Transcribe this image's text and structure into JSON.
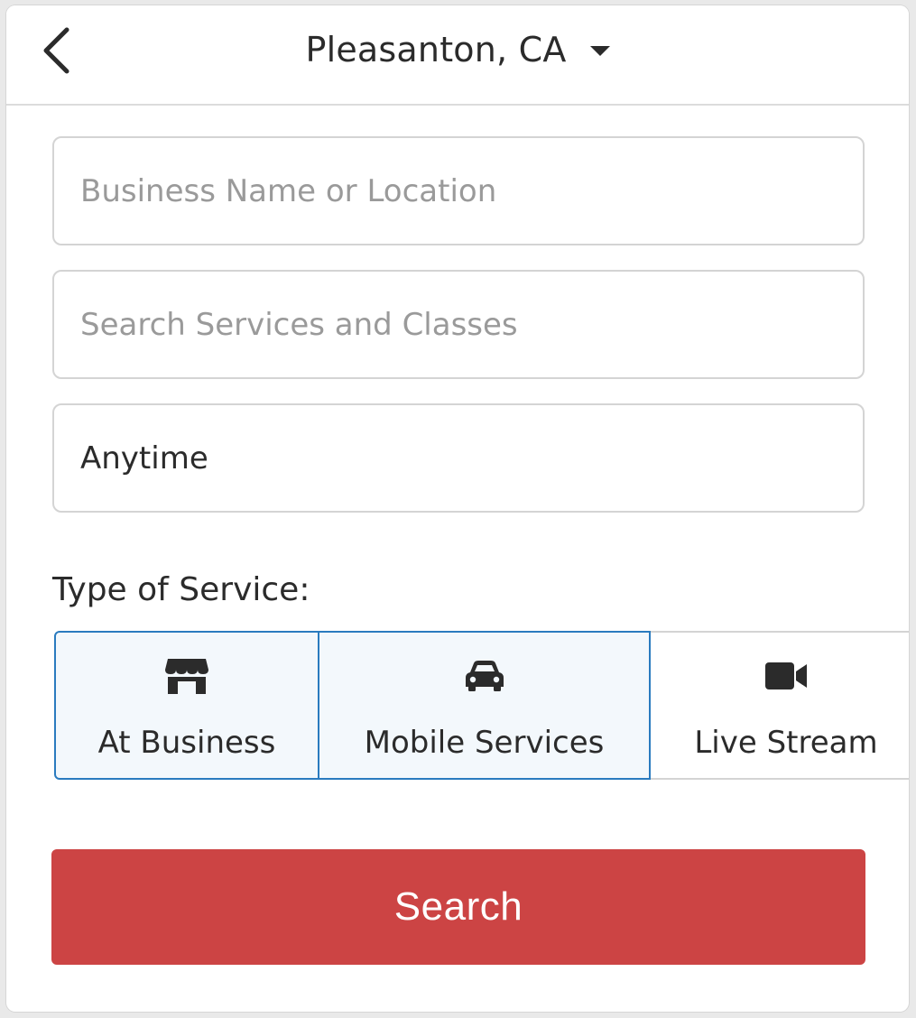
{
  "header": {
    "location": "Pleasanton, CA",
    "back_icon": "chevron-left-icon",
    "dropdown_icon": "caret-down-icon"
  },
  "search": {
    "business_placeholder": "Business Name or Location",
    "services_placeholder": "Search Services and Classes",
    "time_value": "Anytime"
  },
  "service_type": {
    "label": "Type of Service:",
    "options": [
      {
        "label": "At Business",
        "icon": "storefront-icon",
        "selected": true
      },
      {
        "label": "Mobile Services",
        "icon": "car-icon",
        "selected": true
      },
      {
        "label": "Live Stream",
        "icon": "video-camera-icon",
        "selected": false
      }
    ]
  },
  "actions": {
    "search_label": "Search"
  },
  "colors": {
    "accent": "#cc4444",
    "selected_border": "#2a7bbf",
    "selected_bg": "#f3f8fc"
  }
}
